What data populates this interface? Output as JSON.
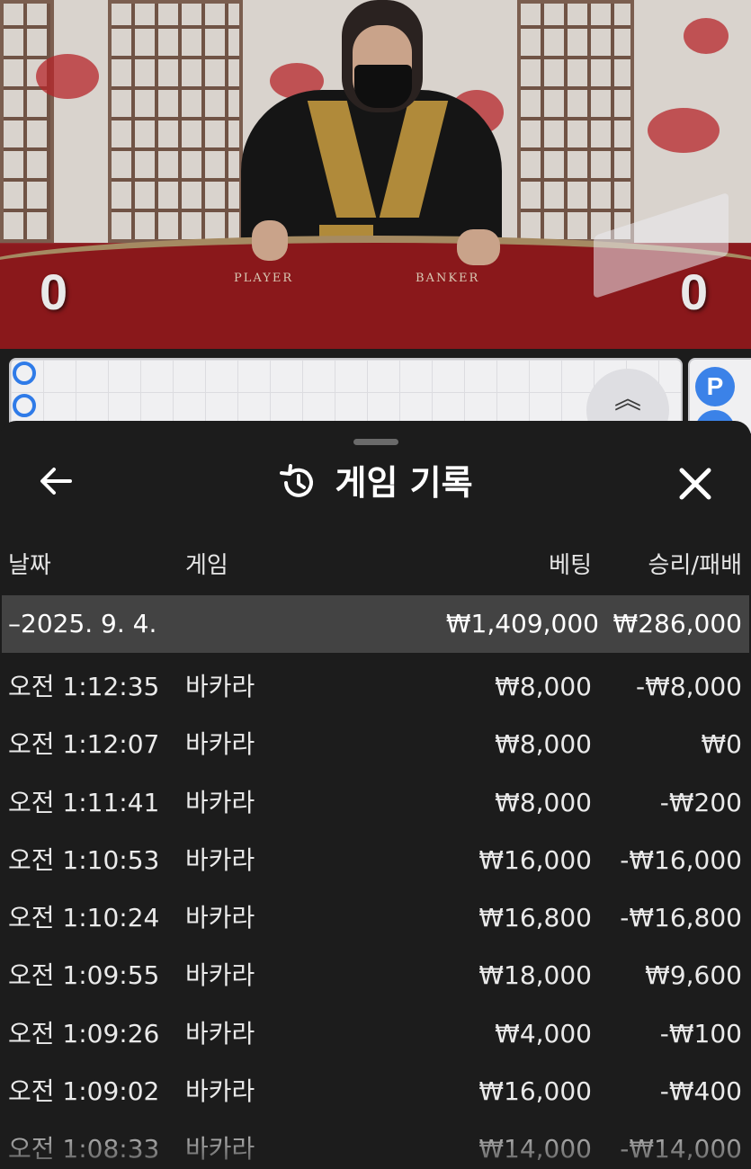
{
  "video": {
    "table_labels": {
      "player": "PLAYER",
      "banker": "BANKER"
    },
    "player_score": "0",
    "banker_score": "0"
  },
  "roadmap": {
    "side_chip": "P",
    "collapse_icon": "chevron-up-double-icon"
  },
  "sheet": {
    "back_icon": "arrow-left-icon",
    "history_icon": "history-icon",
    "title": "게임 기록",
    "close_icon": "close-icon",
    "columns": {
      "date": "날짜",
      "game": "게임",
      "bet": "베팅",
      "win_loss": "승리/패배"
    },
    "day": {
      "date": "–2025. 9. 4.",
      "bet_total": "₩1,409,000",
      "win_total": "₩286,000"
    },
    "rows": [
      {
        "time": "오전 1:12:35",
        "game": "바카라",
        "bet": "₩8,000",
        "result": "-₩8,000"
      },
      {
        "time": "오전 1:12:07",
        "game": "바카라",
        "bet": "₩8,000",
        "result": "₩0"
      },
      {
        "time": "오전 1:11:41",
        "game": "바카라",
        "bet": "₩8,000",
        "result": "-₩200"
      },
      {
        "time": "오전 1:10:53",
        "game": "바카라",
        "bet": "₩16,000",
        "result": "-₩16,000"
      },
      {
        "time": "오전 1:10:24",
        "game": "바카라",
        "bet": "₩16,800",
        "result": "-₩16,800"
      },
      {
        "time": "오전 1:09:55",
        "game": "바카라",
        "bet": "₩18,000",
        "result": "₩9,600"
      },
      {
        "time": "오전 1:09:26",
        "game": "바카라",
        "bet": "₩4,000",
        "result": "-₩100"
      },
      {
        "time": "오전 1:09:02",
        "game": "바카라",
        "bet": "₩16,000",
        "result": "-₩400"
      },
      {
        "time": "오전 1:08:33",
        "game": "바카라",
        "bet": "₩14,000",
        "result": "-₩14,000"
      }
    ]
  }
}
